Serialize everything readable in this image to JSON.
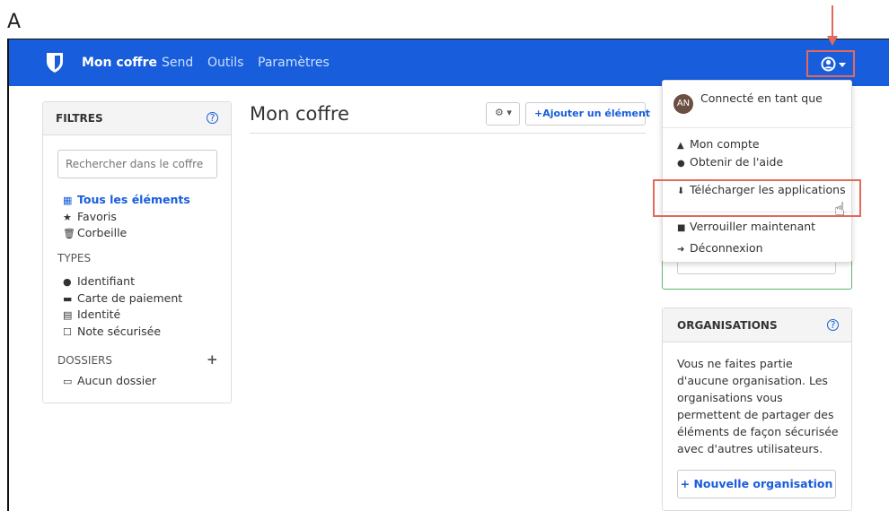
{
  "figure_label": "A",
  "nav": {
    "items": [
      {
        "label": "Mon coffre",
        "active": true
      },
      {
        "label": "Send",
        "active": false
      },
      {
        "label": "Outils",
        "active": false
      },
      {
        "label": "Paramètres",
        "active": false
      }
    ]
  },
  "filters": {
    "title": "FILTRES",
    "search_placeholder": "Rechercher dans le coffre",
    "vault_items": [
      {
        "icon": "grid-icon",
        "label": "Tous les éléments",
        "selected": true
      },
      {
        "icon": "star-icon",
        "label": "Favoris",
        "selected": false
      },
      {
        "icon": "trash-icon",
        "label": "Corbeille",
        "selected": false
      }
    ],
    "types_heading": "TYPES",
    "types": [
      {
        "icon": "globe-icon",
        "label": "Identifiant"
      },
      {
        "icon": "credit-card-icon",
        "label": "Carte de paiement"
      },
      {
        "icon": "id-card-icon",
        "label": "Identité"
      },
      {
        "icon": "sticky-note-icon",
        "label": "Note sécurisée"
      }
    ],
    "folders_heading": "DOSSIERS",
    "folders": [
      {
        "icon": "folder-icon",
        "label": "Aucun dossier"
      }
    ]
  },
  "main": {
    "title": "Mon coffre",
    "add_item_label": "Ajouter un élément"
  },
  "dropdown": {
    "avatar_initials": "AN",
    "logged_in_as": "Connecté en tant que",
    "items": [
      {
        "icon": "user-icon",
        "label": "Mon compte"
      },
      {
        "icon": "question-circle-icon",
        "label": "Obtenir de l'aide"
      },
      {
        "icon": "download-icon",
        "label": "Télécharger les applications"
      },
      {
        "icon": "lock-icon",
        "label": "Verrouiller maintenant"
      },
      {
        "icon": "sign-out-icon",
        "label": "Déconnexion"
      }
    ]
  },
  "organizations": {
    "title": "ORGANISATIONS",
    "description": "Vous ne faites partie d'aucune organisation. Les organisations vous permettent de partager des éléments de façon sécurisée avec d'autres utilisateurs.",
    "new_org_label": "Nouvelle organisation"
  },
  "colors": {
    "brand_blue": "#175ddc",
    "highlight_red": "#e36a5b",
    "premium_green": "#5bb86a"
  }
}
